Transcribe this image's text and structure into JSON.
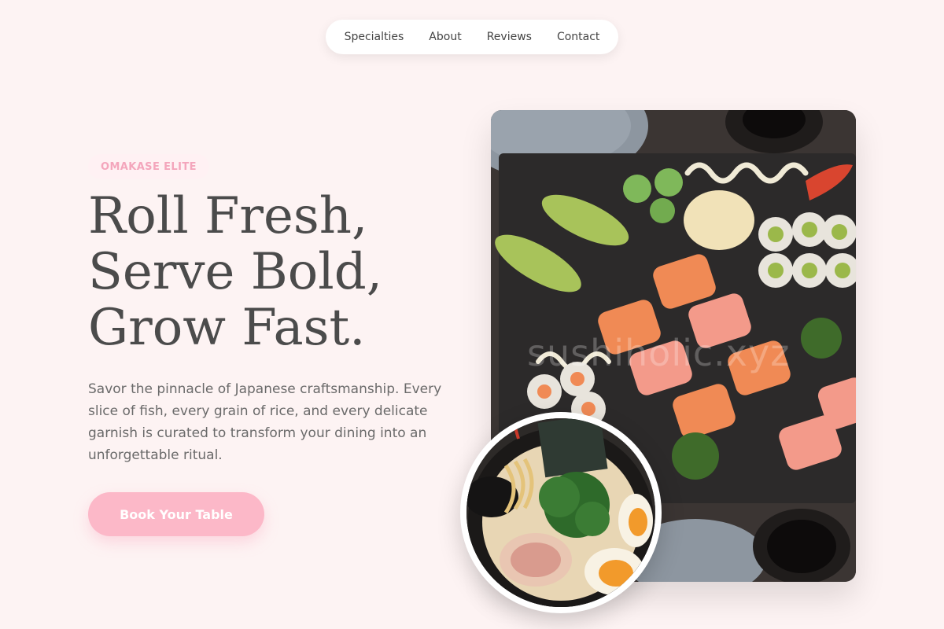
{
  "nav": {
    "items": [
      {
        "label": "Specialties"
      },
      {
        "label": "About"
      },
      {
        "label": "Reviews"
      },
      {
        "label": "Contact"
      }
    ]
  },
  "hero": {
    "badge": "OMAKASE ELITE",
    "headline": [
      "Roll Fresh,",
      "Serve Bold,",
      "Grow Fast."
    ],
    "description": "Savor the pinnacle of Japanese craftsmanship. Every slice of fish, every grain of rice, and every delicate garnish is curated to transform your dining into an unforgettable ritual.",
    "cta_label": "Book Your Table"
  },
  "images": {
    "main_photo": "sushi-platter-photo",
    "main_watermark": "sushiholic.xyz",
    "round_photo": "ramen-bowl-photo"
  },
  "colors": {
    "background": "#fdf3f3",
    "accent_pink": "#fcb8c8",
    "badge_text": "#f4a6bc",
    "heading": "#4b4b4b"
  }
}
